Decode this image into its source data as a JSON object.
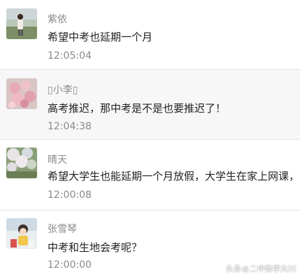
{
  "comments": [
    {
      "name": "紫依",
      "text": "希望中考也延期一个月",
      "time": "12:05:04",
      "avatar_icon": "person-in-field-photo"
    },
    {
      "name": "▯小李▯",
      "text": "高考推迟，那中考是不是也要推迟了！",
      "time": "12:04:38",
      "avatar_icon": "pink-flowers-photo"
    },
    {
      "name": "晴天",
      "text": "希望大学生也能延期一个月放假，大学生在家上网课，",
      "time": "12:00:08",
      "avatar_icon": "blossom-tree-photo"
    },
    {
      "name": "张雪琴",
      "text": "中考和生地会考呢？",
      "time": "12:00:00",
      "avatar_icon": "cartoon-figure-photo"
    }
  ],
  "watermark": {
    "prefix": "头条",
    "at": "@",
    "account": "二中数学大川"
  },
  "colors": {
    "name": "#8a8a8a",
    "text": "#222222",
    "divider": "#e6e6e6",
    "alt_row": "#f7f7f7"
  }
}
